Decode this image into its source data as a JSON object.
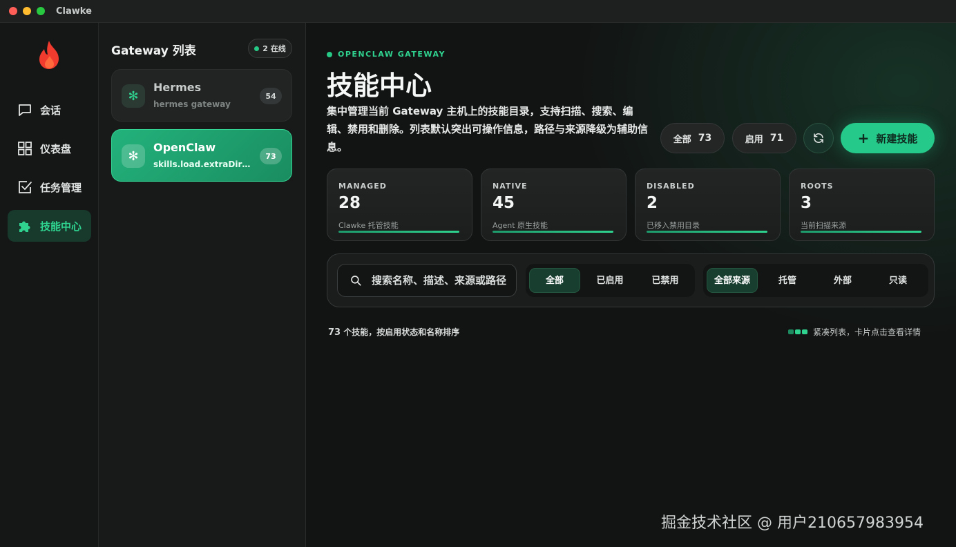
{
  "window": {
    "title": "Clawke"
  },
  "nav": {
    "items": [
      {
        "label": "会话",
        "icon": "chat-bubble-icon"
      },
      {
        "label": "仪表盘",
        "icon": "grid-icon"
      },
      {
        "label": "任务管理",
        "icon": "checkbox-icon"
      },
      {
        "label": "技能中心",
        "icon": "puzzle-icon",
        "active": true
      }
    ]
  },
  "gateway_panel": {
    "title": "Gateway 列表",
    "online_label": "2 在线",
    "gateways": [
      {
        "name": "Hermes",
        "subtitle": "hermes gateway",
        "count": "54",
        "selected": false
      },
      {
        "name": "OpenClaw",
        "subtitle": "skills.load.extraDirs ...",
        "count": "73",
        "selected": true
      }
    ]
  },
  "header": {
    "eyebrow": "OPENCLAW GATEWAY",
    "title": "技能中心",
    "description": "集中管理当前 Gateway 主机上的技能目录，支持扫描、搜索、编辑、禁用和删除。列表默认突出可操作信息，路径与来源降级为辅助信息。",
    "total_label": "全部",
    "total_value": "73",
    "enabled_label": "启用",
    "enabled_value": "71",
    "new_button": "新建技能"
  },
  "stats": [
    {
      "label": "MANAGED",
      "value": "28",
      "desc": "Clawke 托管技能",
      "fill": 1.0
    },
    {
      "label": "NATIVE",
      "value": "45",
      "desc": "Agent 原生技能",
      "fill": 1.0
    },
    {
      "label": "DISABLED",
      "value": "2",
      "desc": "已移入禁用目录",
      "fill": 1.0
    },
    {
      "label": "ROOTS",
      "value": "3",
      "desc": "当前扫描来源",
      "fill": 1.0
    }
  ],
  "filters": {
    "search_placeholder": "搜索名称、描述、来源或路径",
    "status": [
      "全部",
      "已启用",
      "已禁用"
    ],
    "status_selected": "全部",
    "source": [
      "全部来源",
      "托管",
      "外部",
      "只读"
    ],
    "source_selected": "全部来源"
  },
  "list": {
    "count": "73",
    "summary_suffix": " 个技能，按启用状态和名称排序",
    "hint": "紧凑列表，卡片点击查看详情"
  },
  "watermark": "掘金技术社区 @ 用户210657983954",
  "colors": {
    "accent": "#2fd28f",
    "accent_dark": "#173a2d",
    "background": "#121313"
  }
}
